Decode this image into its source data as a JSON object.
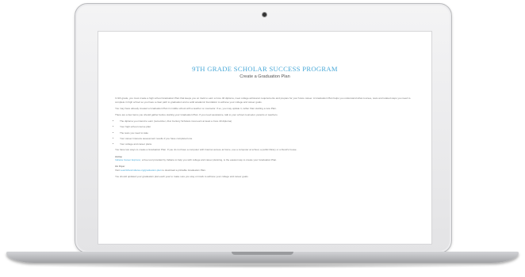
{
  "page": {
    "title": "9TH GRADE SCHOLAR SUCCESS PROGRAM",
    "subtitle": "Create a Graduation Plan"
  },
  "content": {
    "intro": "In 9th grade, you must create a high school Graduation Plan that keeps you on track to earn a Core 40 diploma, meet college admission requirements and prepare for your future career. A Graduation Plan helps you understand what courses, tests and related steps you need to complete in high school so you have a clear path to graduation and a solid academic foundation to achieve your college and career goals.",
    "middle_school": "You may have already created a Graduation Plan in middle school with a teacher or counselor. If so, you may update it, rather than starting a new Plan.",
    "items_intro": "There are a few items you should gather before starting your Graduation Plan. If you need assistance, talk to your school counselor, parents or teachers.",
    "items": [
      "The diploma you intend to earn (remember, 21st Century Scholars must earn at least a Core 40 diploma)",
      "Your high school course plan",
      "The tests you need to take",
      "Your career interests assessment results if you have completed one",
      "Your college and career plans"
    ],
    "two_ways": "You have two ways to create a Graduation Plan. If you do not have a computer with Internet access at home, use a computer at school, a public library or a friend's house.",
    "online_heading": "Online",
    "online_link": "Indiana Career Explorer",
    "online_text": ", a free tool provided by Indiana to help you with college and career planning, is the easiest way to create your Graduation Plan.",
    "paper_heading": "On Paper",
    "paper_prefix": "Visit ",
    "paper_link": "LearnMoreIndiana.org/graduation-plan",
    "paper_text": " to download a printable Graduation Plan.",
    "update": "You should updated your graduation plan each year to make sure you stay on track to achieve your college and career goals."
  }
}
